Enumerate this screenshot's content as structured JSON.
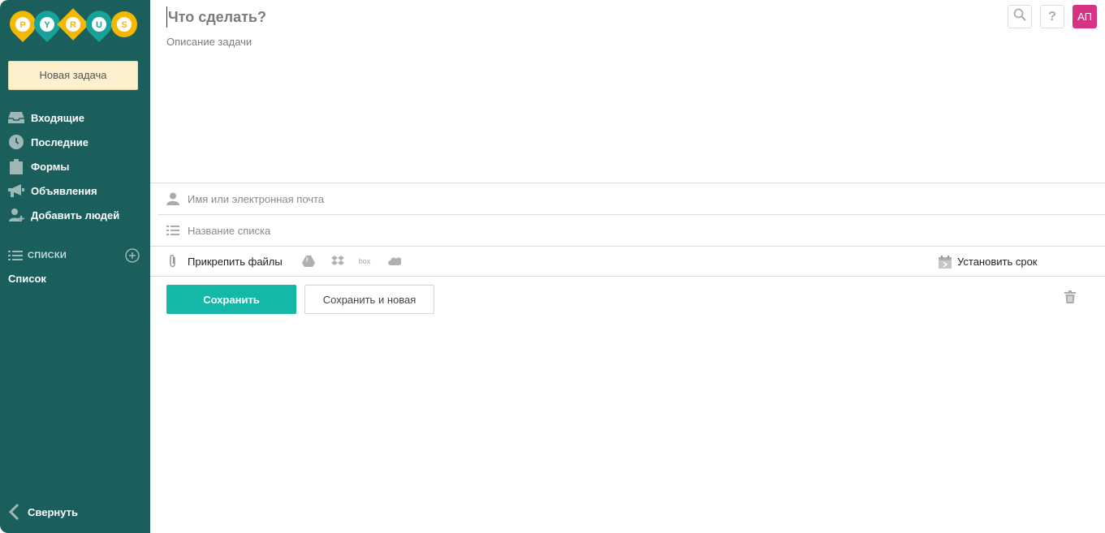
{
  "brand": {
    "logo_letters": [
      "P",
      "Y",
      "R",
      "U",
      "S"
    ],
    "colors": {
      "sidebar_bg": "#1b5f5c",
      "logo_yellow": "#f5b800",
      "logo_teal": "#17a39a",
      "primary_button": "#15b7a8",
      "avatar_bg": "#d63384",
      "new_task_bg": "#fdf0cc"
    }
  },
  "sidebar": {
    "new_task_label": "Новая задача",
    "nav": [
      {
        "label": "Входящие",
        "icon": "inbox-icon"
      },
      {
        "label": "Последние",
        "icon": "clock-icon"
      },
      {
        "label": "Формы",
        "icon": "clipboard-icon"
      },
      {
        "label": "Объявления",
        "icon": "megaphone-icon"
      },
      {
        "label": "Добавить людей",
        "icon": "add-user-icon"
      }
    ],
    "lists_header": "СПИСКИ",
    "list_items": [
      {
        "label": "Список"
      }
    ],
    "collapse_label": "Свернуть"
  },
  "header": {
    "avatar_initials": "АП",
    "search_icon": "search-icon",
    "help_icon": "question-icon"
  },
  "task": {
    "title_placeholder": "Что сделать?",
    "description_placeholder": "Описание задачи",
    "assignee_placeholder": "Имя или электронная почта",
    "list_placeholder": "Название списка",
    "attach_label": "Прикрепить файлы",
    "cloud_services": [
      "google-drive-icon",
      "dropbox-icon",
      "box-icon",
      "onedrive-icon"
    ],
    "box_label": "box",
    "deadline_label": "Установить срок"
  },
  "actions": {
    "save_label": "Сохранить",
    "save_new_label": "Сохранить и новая"
  }
}
